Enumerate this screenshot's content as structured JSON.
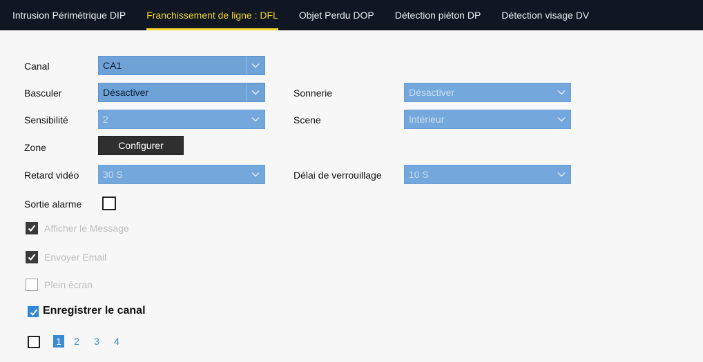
{
  "tabs": [
    {
      "label": "Intrusion Périmétrique DIP"
    },
    {
      "label": "Franchissement de ligne : DFL"
    },
    {
      "label": "Objet Perdu DOP"
    },
    {
      "label": "Détection piéton DP"
    },
    {
      "label": "Détection visage DV"
    }
  ],
  "form": {
    "canal": {
      "label": "Canal",
      "value": "CA1"
    },
    "basculer": {
      "label": "Basculer",
      "value": "Désactiver"
    },
    "sonnerie": {
      "label": "Sonnerie",
      "value": "Désactiver"
    },
    "sensibilite": {
      "label": "Sensibilité",
      "value": "2"
    },
    "scene": {
      "label": "Scene",
      "value": "Intérieur"
    },
    "zone": {
      "label": "Zone",
      "button": "Configurer"
    },
    "retard_video": {
      "label": "Retard vidéo",
      "value": "30 S"
    },
    "delai_verrouillage": {
      "label": "Délai de verrouillage",
      "value": "10 S"
    },
    "sortie_alarme": {
      "label": "Sortie alarme",
      "checked": false
    }
  },
  "options": {
    "afficher_message": {
      "label": "Afficher le Message",
      "checked": true
    },
    "envoyer_email": {
      "label": "Envoyer Email",
      "checked": true
    },
    "plein_ecran": {
      "label": "Plein écran",
      "checked": false
    },
    "enregistrer_canal": {
      "label": "Enregistrer le canal",
      "checked": true
    }
  },
  "channels": {
    "all_checked": false,
    "items": [
      "1",
      "2",
      "3",
      "4"
    ],
    "selected": "1"
  },
  "colors": {
    "accent": "#f3d42a",
    "topbar": "#101722",
    "select_bg": "#6fa3d8",
    "link_blue": "#3a8bd3"
  }
}
